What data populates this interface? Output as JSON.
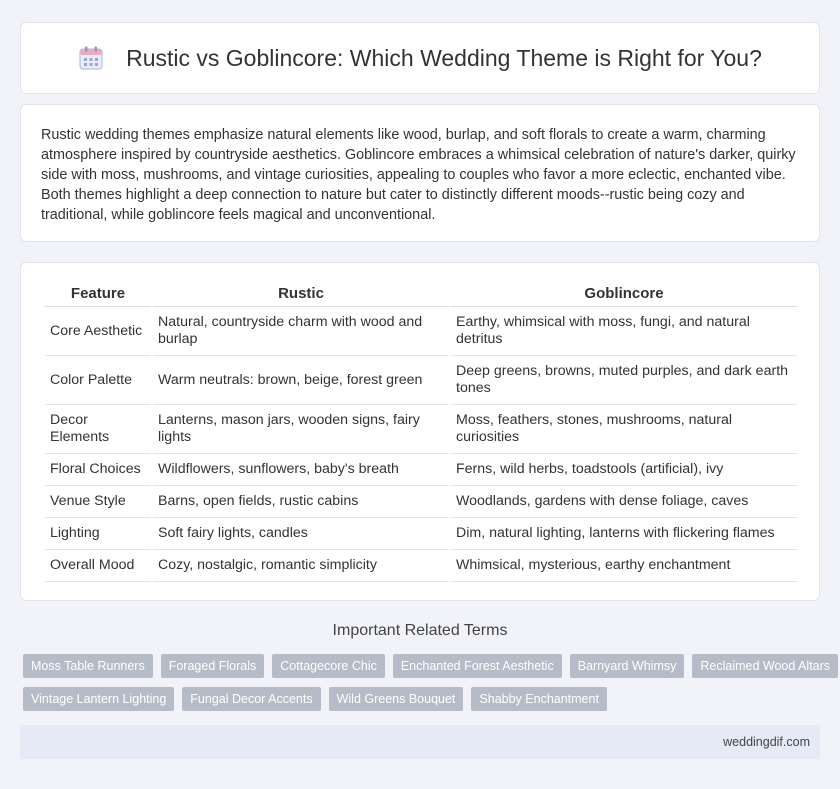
{
  "header": {
    "title": "Rustic vs Goblincore: Which Wedding Theme is Right for You?",
    "icon": "calendar-icon"
  },
  "intro": "Rustic wedding themes emphasize natural elements like wood, burlap, and soft florals to create a warm, charming atmosphere inspired by countryside aesthetics. Goblincore embraces a whimsical celebration of nature's darker, quirky side with moss, mushrooms, and vintage curiosities, appealing to couples who favor a more eclectic, enchanted vibe. Both themes highlight a deep connection to nature but cater to distinctly different moods--rustic being cozy and traditional, while goblincore feels magical and unconventional.",
  "table": {
    "headers": [
      "Feature",
      "Rustic",
      "Goblincore"
    ],
    "rows": [
      [
        "Core Aesthetic",
        "Natural, countryside charm with wood and burlap",
        "Earthy, whimsical with moss, fungi, and natural detritus"
      ],
      [
        "Color Palette",
        "Warm neutrals: brown, beige, forest green",
        "Deep greens, browns, muted purples, and dark earth tones"
      ],
      [
        "Decor Elements",
        "Lanterns, mason jars, wooden signs, fairy lights",
        "Moss, feathers, stones, mushrooms, natural curiosities"
      ],
      [
        "Floral Choices",
        "Wildflowers, sunflowers, baby's breath",
        "Ferns, wild herbs, toadstools (artificial), ivy"
      ],
      [
        "Venue Style",
        "Barns, open fields, rustic cabins",
        "Woodlands, gardens with dense foliage, caves"
      ],
      [
        "Lighting",
        "Soft fairy lights, candles",
        "Dim, natural lighting, lanterns with flickering flames"
      ],
      [
        "Overall Mood",
        "Cozy, nostalgic, romantic simplicity",
        "Whimsical, mysterious, earthy enchantment"
      ]
    ]
  },
  "related": {
    "title": "Important Related Terms",
    "tags_row1": [
      "Moss Table Runners",
      "Foraged Florals",
      "Cottagecore Chic",
      "Enchanted Forest Aesthetic",
      "Barnyard Whimsy",
      "Reclaimed Wood Altars"
    ],
    "tags_row2": [
      "Vintage Lantern Lighting",
      "Fungal Decor Accents",
      "Wild Greens Bouquet",
      "Shabby Enchantment"
    ]
  },
  "footer": "weddingdif.com"
}
